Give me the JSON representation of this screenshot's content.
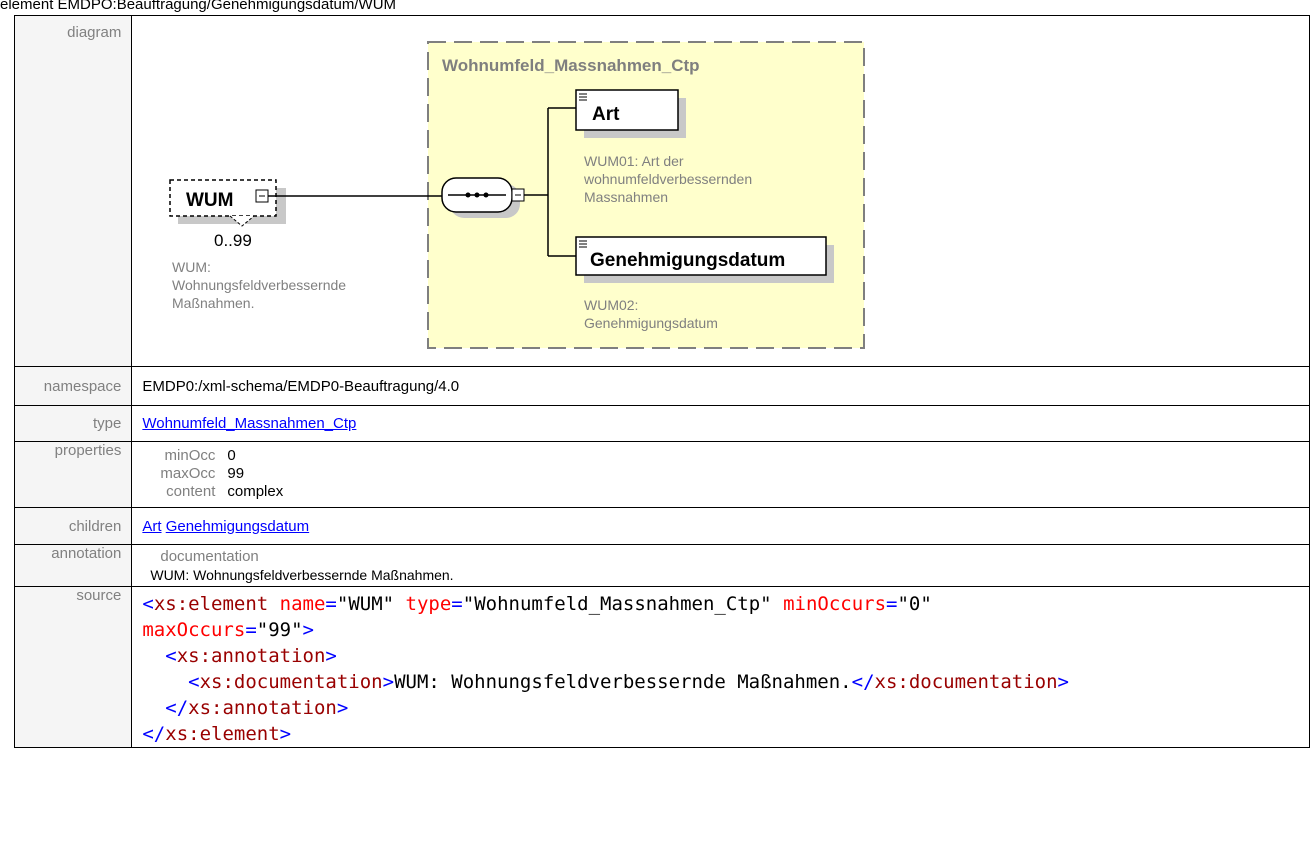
{
  "header_text": "element EMDPO:Beauftragung/Genehmigungsdatum/WUM",
  "labels": {
    "diagram": "diagram",
    "namespace": "namespace",
    "type": "type",
    "properties": "properties",
    "children": "children",
    "annotation": "annotation",
    "source": "source"
  },
  "diagram": {
    "element_name": "WUM",
    "occurrence": "0..99",
    "element_doc": [
      "WUM:",
      "Wohnungsfeldverbessernde",
      "Maßnahmen."
    ],
    "type_name": "Wohnumfeld_Massnahmen_Ctp",
    "children": [
      {
        "name": "Art",
        "doc": [
          "WUM01: Art der",
          "wohnumfeldverbessernden",
          "Massnahmen"
        ]
      },
      {
        "name": "Genehmigungsdatum",
        "doc": [
          "WUM02:",
          "Genehmigungsdatum"
        ]
      }
    ],
    "colors": {
      "type_box_fill": "#ffffcc",
      "type_box_border": "#7f7f7f",
      "doc_text": "#808080"
    }
  },
  "namespace": "EMDP0:/xml-schema/EMDP0-Beauftragung/4.0",
  "type_link": "Wohnumfeld_Massnahmen_Ctp",
  "properties": [
    {
      "key": "minOcc",
      "value": "0"
    },
    {
      "key": "maxOcc",
      "value": "99"
    },
    {
      "key": "content",
      "value": "complex"
    }
  ],
  "children_links": [
    "Art",
    "Genehmigungsdatum"
  ],
  "annotation": {
    "key": "documentation",
    "value": "WUM: Wohnungsfeldverbessernde Maßnahmen."
  },
  "source": {
    "l1_open": "<",
    "l1_tag": "xs:element",
    "l1_a1": "name",
    "l1_v1": "\"WUM\"",
    "l1_a2": "type",
    "l1_v2": "\"Wohnumfeld_Massnahmen_Ctp\"",
    "l1_a3": "minOccurs",
    "l1_v3": "\"0\"",
    "l2_a1": "maxOccurs",
    "l2_v1": "\"99\"",
    "l2_close": ">",
    "l3_open": "<",
    "l3_tag": "xs:annotation",
    "l3_close": ">",
    "l4_open": "<",
    "l4_tag": "xs:documentation",
    "l4_gt": ">",
    "l4_text": "WUM: Wohnungsfeldverbessernde Maßnahmen.",
    "l4_end_open": "</",
    "l4_end_tag": "xs:documentation",
    "l4_end_close": ">",
    "l5_open": "</",
    "l5_tag": "xs:annotation",
    "l5_close": ">",
    "l6_open": "</",
    "l6_tag": "xs:element",
    "l6_close": ">"
  }
}
